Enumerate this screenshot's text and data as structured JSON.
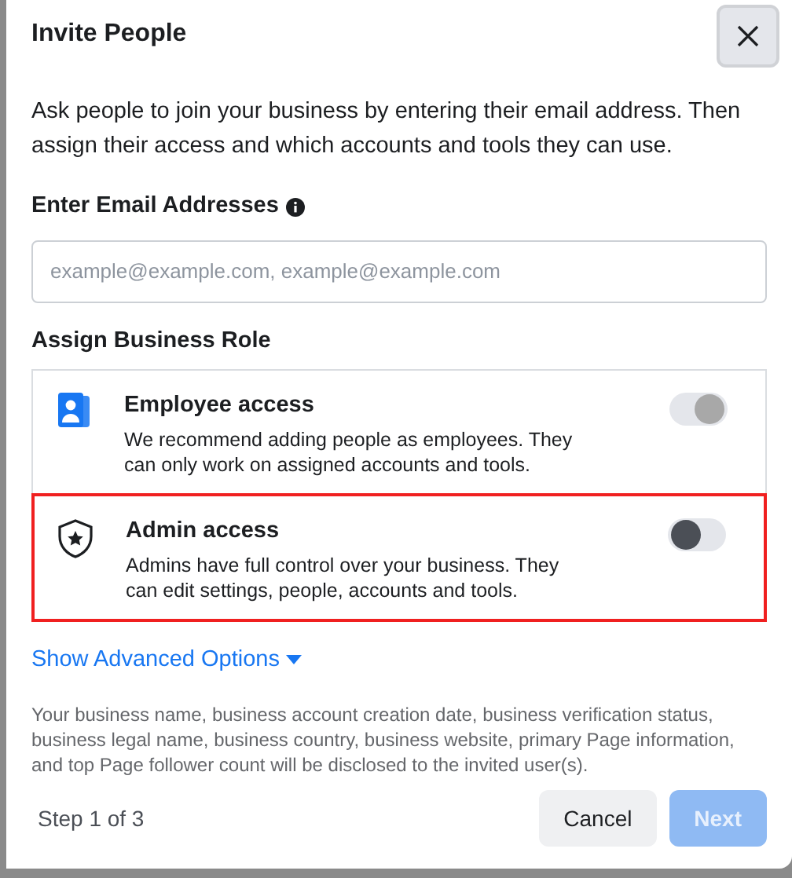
{
  "dialog": {
    "title": "Invite People",
    "description": "Ask people to join your business by entering their email address. Then assign their access and which accounts and tools they can use.",
    "email": {
      "label": "Enter Email Addresses",
      "placeholder": "example@example.com, example@example.com"
    },
    "roles_heading": "Assign Business Role",
    "roles": [
      {
        "kind": "employee",
        "title": "Employee access",
        "description": "We recommend adding people as employees. They can only work on assigned accounts and tools.",
        "on": true,
        "highlighted": false
      },
      {
        "kind": "admin",
        "title": "Admin access",
        "description": "Admins have full control over your business. They can edit settings, people, accounts and tools.",
        "on": false,
        "highlighted": true
      }
    ],
    "advanced_link": "Show Advanced Options",
    "disclaimer": "Your business name, business account creation date, business verification status, business legal name, business country, business website, primary Page information, and top Page follower count will be disclosed to the invited user(s).",
    "step": "Step 1 of 3",
    "buttons": [
      {
        "label": "Cancel",
        "kind": "secondary",
        "disabled": false
      },
      {
        "label": "Next",
        "kind": "primary",
        "disabled": true
      }
    ]
  }
}
